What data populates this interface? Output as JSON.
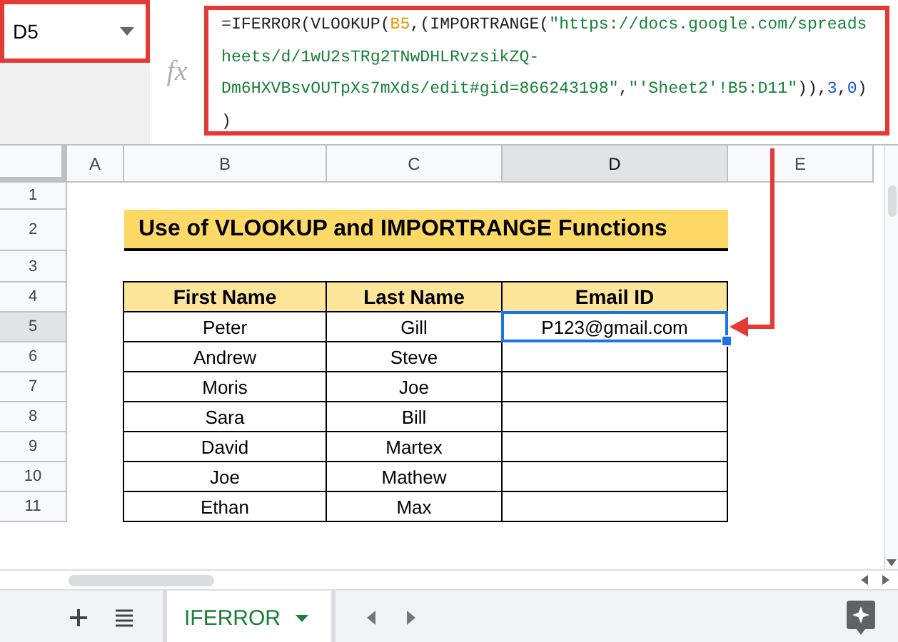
{
  "name_box": {
    "value": "D5"
  },
  "formula_bar": {
    "fx": "fx",
    "lines": [
      [
        {
          "kind": "plain",
          "text": "=IFERROR(VLOOKUP("
        },
        {
          "kind": "ref",
          "text": "B5"
        },
        {
          "kind": "plain",
          "text": ",(IMPORTRANGE("
        },
        {
          "kind": "string",
          "text": "\"https://docs.google.com/spreads"
        }
      ],
      [
        {
          "kind": "string",
          "text": "heets/d/1wU2sTRg2TNwDHLRvzsikZQ-"
        }
      ],
      [
        {
          "kind": "string",
          "text": "Dm6HXVBsvOUTpXs7mXds/edit#gid=866243198\""
        },
        {
          "kind": "plain",
          "text": ","
        },
        {
          "kind": "string",
          "text": "\"'Sheet2'!B5:D11\""
        },
        {
          "kind": "plain",
          "text": ")),"
        },
        {
          "kind": "number",
          "text": "3"
        },
        {
          "kind": "plain",
          "text": ","
        },
        {
          "kind": "number",
          "text": "0"
        },
        {
          "kind": "plain",
          "text": ")"
        }
      ],
      [
        {
          "kind": "plain",
          "text": ")"
        }
      ]
    ]
  },
  "columns": [
    {
      "label": "A",
      "selected": false
    },
    {
      "label": "B",
      "selected": false
    },
    {
      "label": "C",
      "selected": false
    },
    {
      "label": "D",
      "selected": true
    },
    {
      "label": "E",
      "selected": false
    }
  ],
  "rows": [
    {
      "label": "1",
      "selected": false
    },
    {
      "label": "2",
      "selected": false
    },
    {
      "label": "3",
      "selected": false
    },
    {
      "label": "4",
      "selected": false
    },
    {
      "label": "5",
      "selected": true
    },
    {
      "label": "6",
      "selected": false
    },
    {
      "label": "7",
      "selected": false
    },
    {
      "label": "8",
      "selected": false
    },
    {
      "label": "9",
      "selected": false
    },
    {
      "label": "10",
      "selected": false
    },
    {
      "label": "11",
      "selected": false
    }
  ],
  "title": {
    "text": "Use of VLOOKUP and IMPORTRANGE Functions"
  },
  "table": {
    "columns": [
      "First Name",
      "Last Name",
      "Email ID"
    ],
    "rows": [
      [
        {
          "text": "Peter",
          "selected": false
        },
        {
          "text": "Gill",
          "selected": false
        },
        {
          "text": "P123@gmail.com",
          "selected": true
        }
      ],
      [
        {
          "text": "Andrew",
          "selected": false
        },
        {
          "text": "Steve",
          "selected": false
        },
        {
          "selected": false
        }
      ],
      [
        {
          "text": "Moris",
          "selected": false
        },
        {
          "text": "Joe",
          "selected": false
        },
        {
          "selected": false
        }
      ],
      [
        {
          "text": "Sara",
          "selected": false
        },
        {
          "text": "Bill",
          "selected": false
        },
        {
          "selected": false
        }
      ],
      [
        {
          "text": "David",
          "selected": false
        },
        {
          "text": "Martex",
          "selected": false
        },
        {
          "selected": false
        }
      ],
      [
        {
          "text": "Joe",
          "selected": false
        },
        {
          "text": "Mathew",
          "selected": false
        },
        {
          "selected": false
        }
      ],
      [
        {
          "text": "Ethan",
          "selected": false
        },
        {
          "text": "Max",
          "selected": false
        },
        {
          "selected": false
        }
      ]
    ]
  },
  "sheet_tabs": [
    {
      "label": "IFERROR",
      "selected": true
    }
  ]
}
